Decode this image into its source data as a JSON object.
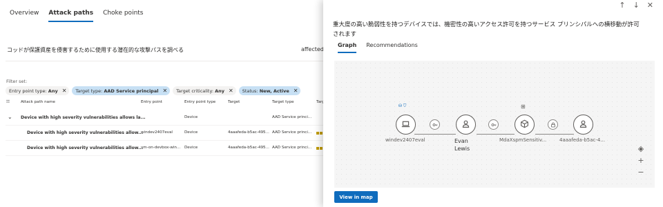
{
  "left": {
    "tabs": [
      "Overview",
      "Attack paths",
      "Choke points"
    ],
    "active_tab_index": 1,
    "description": "コッドが保護資産を侵害するために使用する潜在的な攻撃パスを調べる",
    "affected_text": "affected.",
    "filter_label": "Filter set:",
    "chips": [
      {
        "key": "Entry point type:",
        "value": "Any",
        "selected": false
      },
      {
        "key": "Target type:",
        "value": "AAD Service principal",
        "selected": true
      },
      {
        "key": "Target criticality:",
        "value": "Any",
        "selected": false
      },
      {
        "key": "Status:",
        "value": "New, Active",
        "selected": true
      }
    ],
    "columns": [
      "Attack path name",
      "Entry point",
      "Entry point type",
      "Target",
      "Target type",
      "Targ"
    ],
    "rows": [
      {
        "name": "Device with high severity vulnerabilities allows la...",
        "entry": "",
        "entry_type": "Device",
        "target": "",
        "target_type": "AAD Service princi...",
        "risk": false
      },
      {
        "name": "Device with high severity vulnerabilities allow...",
        "entry": "windev2407eval",
        "entry_type": "Device",
        "target": "4aaafeda-b5ac-495...",
        "target_type": "AAD Service princi...",
        "risk": true
      },
      {
        "name": "Device with high severity vulnerabilities allow...",
        "entry": "vm-on-devbox-win...",
        "entry_type": "Device",
        "target": "4aaafeda-b5ac-495...",
        "target_type": "AAD Service princi...",
        "risk": true
      }
    ]
  },
  "panel": {
    "title": "重大度の高い脆弱性を持つデバイスでは、機密性の高いアクセス許可を持つサービス プリンシパルへの横移動が許可されます",
    "tabs": [
      "Graph",
      "Recommendations"
    ],
    "active_tab_index": 0,
    "nodes": [
      {
        "label": "windev2407eval",
        "icon": "laptop-icon"
      },
      {
        "label": "Evan Lewis",
        "icon": "user-icon"
      },
      {
        "label": "MdaXspmSensitiv...",
        "icon": "cube-icon"
      },
      {
        "label": "4aaafeda-b5ac-4...",
        "icon": "user-icon"
      }
    ],
    "edge_icons": [
      "key-icon",
      "key-icon",
      "lock-icon"
    ],
    "view_button": "View in map",
    "accent": "#0f6cbd"
  }
}
